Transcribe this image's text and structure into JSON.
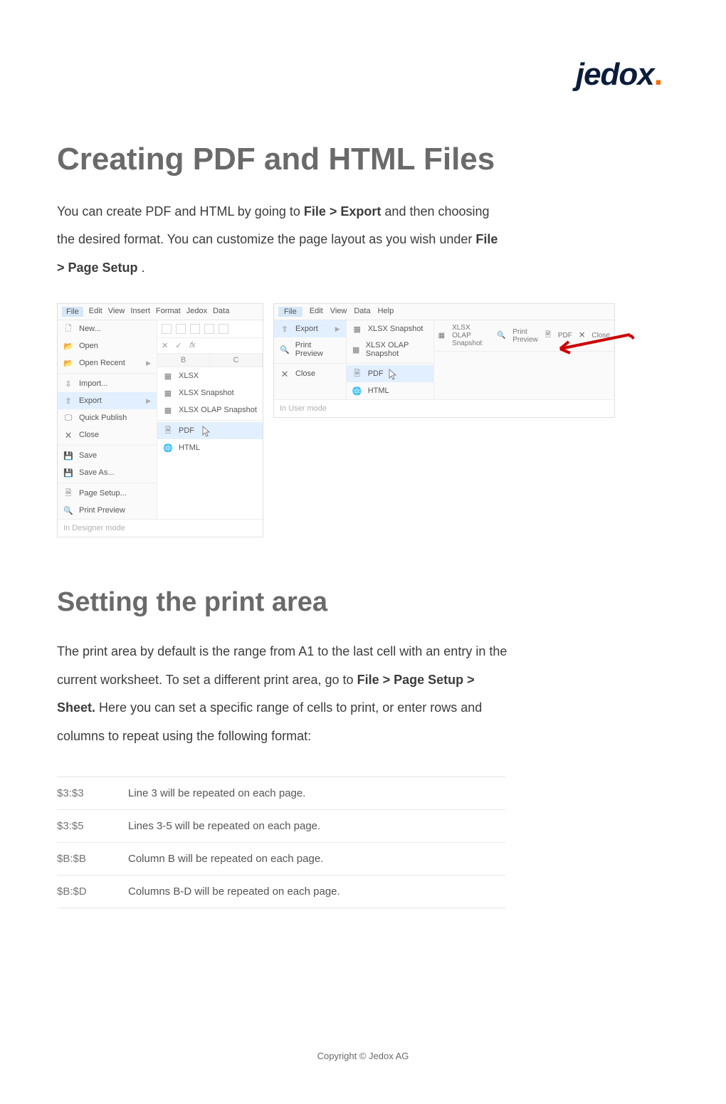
{
  "logo": {
    "text": "jedox",
    "dot": "."
  },
  "title": "Creating PDF and HTML Files",
  "intro_parts": {
    "a": "You can create PDF and HTML by going to ",
    "b": "File > Export",
    "c": " and then choosing the desired format. You can customize the page layout as you wish under ",
    "d": "File > Page Setup",
    "e": "."
  },
  "designer": {
    "menubar": [
      "File",
      "Edit",
      "View",
      "Insert",
      "Format",
      "Jedox",
      "Data"
    ],
    "items_left": [
      "New...",
      "Open",
      "Open Recent",
      "Import...",
      "Export",
      "Quick Publish",
      "Close",
      "Save",
      "Save As...",
      "Page Setup...",
      "Print Preview"
    ],
    "fx": {
      "x": "✕",
      "check": "✓",
      "fx": "𝑓x"
    },
    "cols": [
      "B",
      "C"
    ],
    "export_submenu": [
      "XLSX",
      "XLSX Snapshot",
      "XLSX OLAP Snapshot",
      "PDF",
      "HTML"
    ],
    "mode": "In Designer mode"
  },
  "user": {
    "menubar": [
      "File",
      "Edit",
      "View",
      "Data",
      "Help"
    ],
    "col1": [
      "Export",
      "Print Preview",
      "Close"
    ],
    "col2": [
      "XLSX Snapshot",
      "XLSX OLAP Snapshot",
      "PDF",
      "HTML"
    ],
    "toolbar": [
      "XLSX OLAP Snapshot",
      "Print Preview",
      "PDF",
      "Close"
    ],
    "mode": "In User mode"
  },
  "section2_title": "Setting the print area",
  "section2_para": {
    "a": "The print area by default is the range from A1 to the last cell with an entry in the current worksheet. To set a different print area, go to ",
    "b": "File > Page Setup > Sheet.",
    "c": " Here you can set a specific range of cells to print, or enter rows and columns to repeat using the following format:"
  },
  "format_table": [
    {
      "k": "$3:$3",
      "v": "Line 3 will be repeated on each page."
    },
    {
      "k": "$3:$5",
      "v": "Lines 3-5 will be repeated on each page."
    },
    {
      "k": "$B:$B",
      "v": "Column B will be repeated on each page."
    },
    {
      "k": "$B:$D",
      "v": "Columns B-D will be repeated on each page."
    }
  ],
  "copyright": "Copyright © Jedox AG"
}
